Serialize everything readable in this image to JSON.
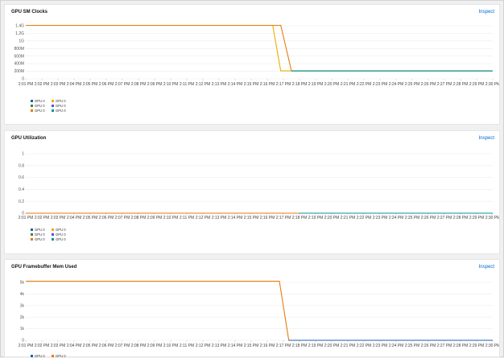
{
  "panels": [
    {
      "id": "clocks",
      "title": "GPU SM Clocks",
      "inspect_label": "Inspect",
      "yticks": [
        "1.4G",
        "1.2G",
        "1G",
        "800M",
        "600M",
        "400M",
        "200M",
        "0"
      ],
      "xticks": [
        "2:01 PM",
        "2:02 PM",
        "2:03 PM",
        "2:04 PM",
        "2:05 PM",
        "2:06 PM",
        "2:07 PM",
        "2:08 PM",
        "2:09 PM",
        "2:10 PM",
        "2:11 PM",
        "2:12 PM",
        "2:13 PM",
        "2:14 PM",
        "2:15 PM",
        "2:16 PM",
        "2:17 PM",
        "2:18 PM",
        "2:19 PM",
        "2:20 PM",
        "2:21 PM",
        "2:22 PM",
        "2:23 PM",
        "2:24 PM",
        "2:25 PM",
        "2:26 PM",
        "2:27 PM",
        "2:28 PM",
        "2:29 PM",
        "2:30 PM"
      ],
      "legend": [
        {
          "label": "GPU 0",
          "color": "#1f5fb0"
        },
        {
          "label": "GPU 0",
          "color": "#f0ab00"
        },
        {
          "label": "GPU 0",
          "color": "#3e8635"
        },
        {
          "label": "GPU 0",
          "color": "#5752d1"
        },
        {
          "label": "GPU 0",
          "color": "#ec7a08"
        },
        {
          "label": "GPU 0",
          "color": "#009596"
        }
      ]
    },
    {
      "id": "util",
      "title": "GPU Utilization",
      "inspect_label": "Inspect",
      "yticks": [
        "1",
        "0.8",
        "0.6",
        "0.4",
        "0.2",
        "0"
      ],
      "xticks": [
        "2:01 PM",
        "2:02 PM",
        "2:03 PM",
        "2:04 PM",
        "2:05 PM",
        "2:06 PM",
        "2:07 PM",
        "2:08 PM",
        "2:09 PM",
        "2:10 PM",
        "2:11 PM",
        "2:12 PM",
        "2:13 PM",
        "2:14 PM",
        "2:15 PM",
        "2:16 PM",
        "2:17 PM",
        "2:18 PM",
        "2:19 PM",
        "2:20 PM",
        "2:21 PM",
        "2:22 PM",
        "2:23 PM",
        "2:24 PM",
        "2:25 PM",
        "2:26 PM",
        "2:27 PM",
        "2:28 PM",
        "2:29 PM",
        "2:30 PM"
      ],
      "legend": [
        {
          "label": "GPU 0",
          "color": "#1f5fb0"
        },
        {
          "label": "GPU 0",
          "color": "#f0ab00"
        },
        {
          "label": "GPU 0",
          "color": "#3e8635"
        },
        {
          "label": "GPU 0",
          "color": "#5752d1"
        },
        {
          "label": "GPU 0",
          "color": "#ec7a08"
        },
        {
          "label": "GPU 0",
          "color": "#009596"
        }
      ]
    },
    {
      "id": "fbmem",
      "title": "GPU Framebuffer Mem Used",
      "inspect_label": "Inspect",
      "yticks": [
        "5k",
        "4k",
        "3k",
        "2k",
        "1k",
        "0"
      ],
      "xticks": [
        "2:01 PM",
        "2:02 PM",
        "2:03 PM",
        "2:04 PM",
        "2:05 PM",
        "2:06 PM",
        "2:07 PM",
        "2:08 PM",
        "2:09 PM",
        "2:10 PM",
        "2:11 PM",
        "2:12 PM",
        "2:13 PM",
        "2:14 PM",
        "2:15 PM",
        "2:16 PM",
        "2:17 PM",
        "2:18 PM",
        "2:19 PM",
        "2:20 PM",
        "2:21 PM",
        "2:22 PM",
        "2:23 PM",
        "2:24 PM",
        "2:25 PM",
        "2:26 PM",
        "2:27 PM",
        "2:28 PM",
        "2:29 PM",
        "2:30 PM"
      ],
      "legend": [
        {
          "label": "GPU 0",
          "color": "#1f5fb0"
        },
        {
          "label": "GPU 0",
          "color": "#ec7a08"
        }
      ]
    }
  ],
  "chart_data": [
    {
      "type": "line",
      "title": "GPU SM Clocks",
      "x": [
        "2:01 PM",
        "2:02 PM",
        "2:03 PM",
        "2:04 PM",
        "2:05 PM",
        "2:06 PM",
        "2:07 PM",
        "2:08 PM",
        "2:09 PM",
        "2:10 PM",
        "2:11 PM",
        "2:12 PM",
        "2:13 PM",
        "2:14 PM",
        "2:15 PM",
        "2:16 PM",
        "2:17 PM",
        "2:18 PM",
        "2:19 PM",
        "2:20 PM",
        "2:21 PM",
        "2:22 PM",
        "2:23 PM",
        "2:24 PM",
        "2:25 PM",
        "2:26 PM",
        "2:27 PM",
        "2:28 PM",
        "2:29 PM",
        "2:30 PM"
      ],
      "ylim": [
        0,
        1400000000
      ],
      "grid": true,
      "legend_position": "bottom-left",
      "series": [
        {
          "name": "GPU 0",
          "color": "#f0ab00",
          "points": [
            [
              "2:01 PM",
              1410000000
            ],
            [
              "2:16:20 PM",
              1410000000
            ],
            [
              "2:16:50 PM",
              210000000
            ],
            [
              "2:30 PM",
              210000000
            ]
          ]
        },
        {
          "name": "GPU 0",
          "color": "#ec7a08",
          "points": [
            [
              "2:01 PM",
              1410000000
            ],
            [
              "2:16:50 PM",
              1410000000
            ],
            [
              "2:17:30 PM",
              210000000
            ],
            [
              "2:30 PM",
              210000000
            ]
          ]
        },
        {
          "name": "GPU 0",
          "color": "#1f5fb0",
          "points": [
            [
              "2:17:30 PM",
              210000000
            ],
            [
              "2:30 PM",
              210000000
            ]
          ]
        },
        {
          "name": "GPU 0",
          "color": "#009596",
          "points": [
            [
              "2:17:30 PM",
              210000000
            ],
            [
              "2:30 PM",
              210000000
            ]
          ]
        }
      ]
    },
    {
      "type": "line",
      "title": "GPU Utilization",
      "x": [
        "2:01 PM",
        "2:02 PM",
        "2:03 PM",
        "2:04 PM",
        "2:05 PM",
        "2:06 PM",
        "2:07 PM",
        "2:08 PM",
        "2:09 PM",
        "2:10 PM",
        "2:11 PM",
        "2:12 PM",
        "2:13 PM",
        "2:14 PM",
        "2:15 PM",
        "2:16 PM",
        "2:17 PM",
        "2:18 PM",
        "2:19 PM",
        "2:20 PM",
        "2:21 PM",
        "2:22 PM",
        "2:23 PM",
        "2:24 PM",
        "2:25 PM",
        "2:26 PM",
        "2:27 PM",
        "2:28 PM",
        "2:29 PM",
        "2:30 PM"
      ],
      "ylim": [
        0,
        1
      ],
      "grid": true,
      "legend_position": "bottom-left",
      "series": [
        {
          "name": "GPU 0",
          "color": "#ec7a08",
          "points": [
            [
              "2:01 PM",
              0
            ],
            [
              "2:30 PM",
              0
            ]
          ]
        },
        {
          "name": "GPU 0",
          "color": "#5752d1",
          "points": [
            [
              "2:18 PM",
              0
            ],
            [
              "2:30 PM",
              0
            ]
          ]
        },
        {
          "name": "GPU 0",
          "color": "#009596",
          "points": [
            [
              "2:18 PM",
              0
            ],
            [
              "2:30 PM",
              0
            ]
          ]
        }
      ]
    },
    {
      "type": "line",
      "title": "GPU Framebuffer Mem Used",
      "x": [
        "2:01 PM",
        "2:02 PM",
        "2:03 PM",
        "2:04 PM",
        "2:05 PM",
        "2:06 PM",
        "2:07 PM",
        "2:08 PM",
        "2:09 PM",
        "2:10 PM",
        "2:11 PM",
        "2:12 PM",
        "2:13 PM",
        "2:14 PM",
        "2:15 PM",
        "2:16 PM",
        "2:17 PM",
        "2:18 PM",
        "2:19 PM",
        "2:20 PM",
        "2:21 PM",
        "2:22 PM",
        "2:23 PM",
        "2:24 PM",
        "2:25 PM",
        "2:26 PM",
        "2:27 PM",
        "2:28 PM",
        "2:29 PM",
        "2:30 PM"
      ],
      "ylim": [
        0,
        5000
      ],
      "grid": true,
      "legend_position": "bottom-left",
      "series": [
        {
          "name": "GPU 0",
          "color": "#ec7a08",
          "points": [
            [
              "2:01 PM",
              5100
            ],
            [
              "2:16:45 PM",
              5100
            ],
            [
              "2:17:20 PM",
              0
            ],
            [
              "2:30 PM",
              0
            ]
          ]
        },
        {
          "name": "GPU 0",
          "color": "#1f5fb0",
          "points": [
            [
              "2:17:20 PM",
              0
            ],
            [
              "2:30 PM",
              0
            ]
          ]
        }
      ]
    }
  ]
}
